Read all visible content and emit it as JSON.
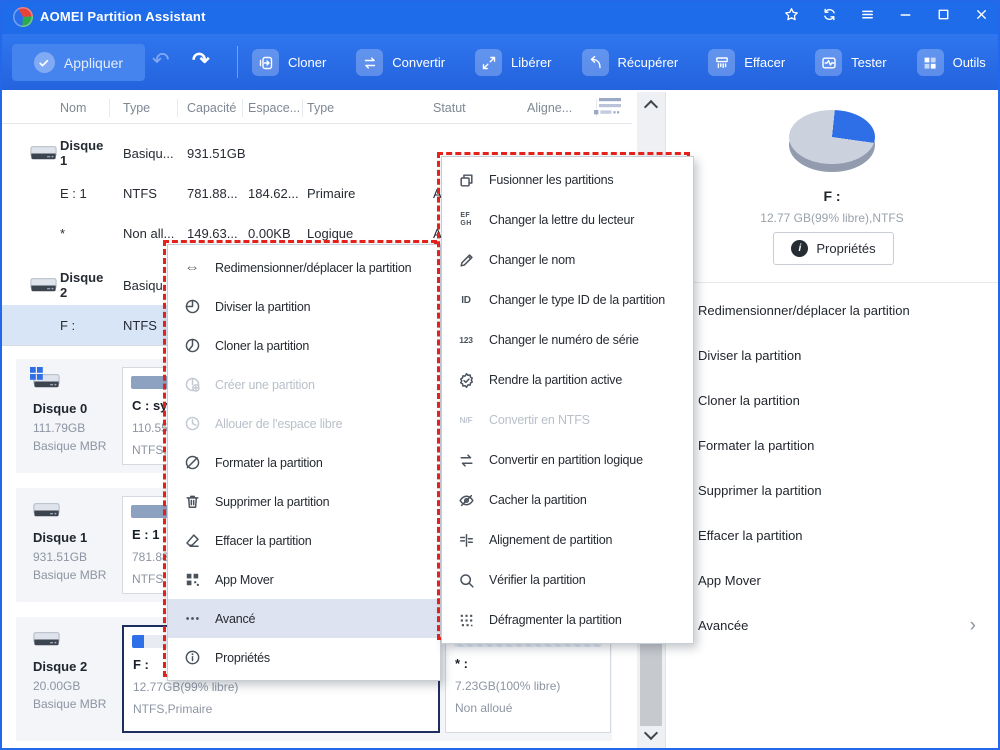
{
  "window": {
    "title": "AOMEI Partition Assistant",
    "controls": [
      {
        "name": "favorite",
        "icon": "star-icon"
      },
      {
        "name": "refresh",
        "icon": "refresh-icon"
      },
      {
        "name": "menu",
        "icon": "hamburger-icon"
      },
      {
        "name": "minimize",
        "icon": "minimize-icon"
      },
      {
        "name": "maximize",
        "icon": "maximize-icon"
      },
      {
        "name": "close",
        "icon": "close-icon"
      }
    ]
  },
  "toolbar": {
    "apply_label": "Appliquer",
    "history": [
      {
        "name": "undo",
        "icon": "undo-icon",
        "disabled": true
      },
      {
        "name": "redo",
        "icon": "redo-icon",
        "disabled": false
      }
    ],
    "buttons": [
      {
        "label": "Cloner",
        "icon": "clone-icon"
      },
      {
        "label": "Convertir",
        "icon": "convert-icon"
      },
      {
        "label": "Libérer",
        "icon": "free-space-icon"
      },
      {
        "label": "Récupérer",
        "icon": "recover-icon"
      },
      {
        "label": "Effacer",
        "icon": "shredder-icon"
      },
      {
        "label": "Tester",
        "icon": "test-icon"
      },
      {
        "label": "Outils",
        "icon": "tools-icon"
      }
    ]
  },
  "table": {
    "headers": [
      "Nom",
      "Type",
      "Capacité",
      "Espace...",
      "Type",
      "Statut",
      "Aligne..."
    ],
    "rows": [
      {
        "kind": "disk",
        "name": "Disque 1",
        "cells": [
          "Basiqu...",
          "931.51GB",
          "",
          "",
          "",
          ""
        ]
      },
      {
        "kind": "partition",
        "name": "E : 1",
        "cells": [
          "NTFS",
          "781.88...",
          "184.62...",
          "Primaire",
          "A",
          ""
        ]
      },
      {
        "kind": "partition",
        "name": "*",
        "cells": [
          "Non all...",
          "149.63...",
          "0.00KB",
          "Logique",
          "A",
          ""
        ]
      },
      {
        "kind": "disk",
        "name": "Disque 2",
        "cells": [
          "Basiqu...",
          "",
          "",
          "",
          "",
          ""
        ]
      },
      {
        "kind": "partition",
        "name": "F :",
        "cells": [
          "NTFS",
          "",
          "",
          "",
          "",
          ""
        ],
        "selected": true
      }
    ]
  },
  "context_menu": {
    "items": [
      {
        "label": "Redimensionner/déplacer la partition",
        "icon": "resize-move-icon"
      },
      {
        "label": "Diviser la partition",
        "icon": "split-partition-icon"
      },
      {
        "label": "Cloner la partition",
        "icon": "clone-partition-icon"
      },
      {
        "label": "Créer une partition",
        "icon": "create-partition-icon",
        "disabled": true
      },
      {
        "label": "Allouer de l'espace libre",
        "icon": "allocate-space-icon",
        "disabled": true
      },
      {
        "label": "Formater la partition",
        "icon": "format-partition-icon"
      },
      {
        "label": "Supprimer la partition",
        "icon": "delete-partition-icon"
      },
      {
        "label": "Effacer la partition",
        "icon": "wipe-partition-icon"
      },
      {
        "label": "App Mover",
        "icon": "app-mover-icon"
      },
      {
        "label": "Avancé",
        "icon": "more-icon",
        "highlighted": true
      },
      {
        "label": "Propriétés",
        "icon": "info-icon"
      }
    ]
  },
  "advanced_menu": {
    "items": [
      {
        "label": "Fusionner les partitions",
        "icon": "merge-partitions-icon"
      },
      {
        "label": "Changer la lettre du lecteur",
        "icon": "drive-letter-icon"
      },
      {
        "label": "Changer le nom",
        "icon": "rename-icon"
      },
      {
        "label": "Changer le type ID de la partition",
        "icon": "type-id-icon"
      },
      {
        "label": "Changer le numéro de série",
        "icon": "serial-number-icon"
      },
      {
        "label": "Rendre la partition active",
        "icon": "set-active-icon"
      },
      {
        "label": "Convertir en NTFS",
        "icon": "convert-ntfs-icon",
        "disabled": true
      },
      {
        "label": "Convertir en partition logique",
        "icon": "convert-logical-icon"
      },
      {
        "label": "Cacher la partition",
        "icon": "hide-partition-icon"
      },
      {
        "label": "Alignement de partition",
        "icon": "alignment-icon"
      },
      {
        "label": "Vérifier la partition",
        "icon": "check-partition-icon"
      },
      {
        "label": "Défragmenter la partition",
        "icon": "defrag-icon"
      }
    ]
  },
  "disk_panel": {
    "disks": [
      {
        "name": "Disque 0",
        "size": "111.79GB",
        "layout": "Basique MBR",
        "system_disk": true,
        "partitions": [
          {
            "label": "C : sy",
            "size": "110.55",
            "fs": "NTFS,",
            "fill_pct": 90
          }
        ]
      },
      {
        "name": "Disque 1",
        "size": "931.51GB",
        "layout": "Basique MBR",
        "system_disk": false,
        "partitions": [
          {
            "label": "E : 1",
            "size": "781.88",
            "fs": "NTFS,",
            "fill_pct": 84
          }
        ]
      },
      {
        "name": "Disque 2",
        "size": "20.00GB",
        "layout": "Basique MBR",
        "system_disk": false,
        "partitions": [
          {
            "label": "F :",
            "size": "12.77GB(99% libre)",
            "fs": "NTFS,Primaire",
            "selected": true,
            "fill_pct": 4
          },
          {
            "label": "* :",
            "size": "7.23GB(100% libre)",
            "fs": "Non alloué",
            "unallocated": true
          }
        ]
      }
    ]
  },
  "sidebar": {
    "volume_label": "F :",
    "volume_info": "12.77 GB(99% libre),NTFS",
    "properties_label": "Propriétés",
    "actions": [
      {
        "label": "Redimensionner/déplacer la partition"
      },
      {
        "label": "Diviser la partition"
      },
      {
        "label": "Cloner la partition"
      },
      {
        "label": "Formater la partition"
      },
      {
        "label": "Supprimer la partition"
      },
      {
        "label": "Effacer la partition"
      },
      {
        "label": "App Mover"
      },
      {
        "label": "Avancée",
        "chevron": true
      }
    ]
  },
  "colors": {
    "accent_blue": "#1e6ce9",
    "selected_row": "#d8e5f6",
    "menu_highlight": "#dde3f0",
    "annotation_red": "#e8221c",
    "selected_partition_border": "#1c2e5e",
    "pie_used": "#2e6fe8",
    "pie_free": "#ccd2dd"
  }
}
